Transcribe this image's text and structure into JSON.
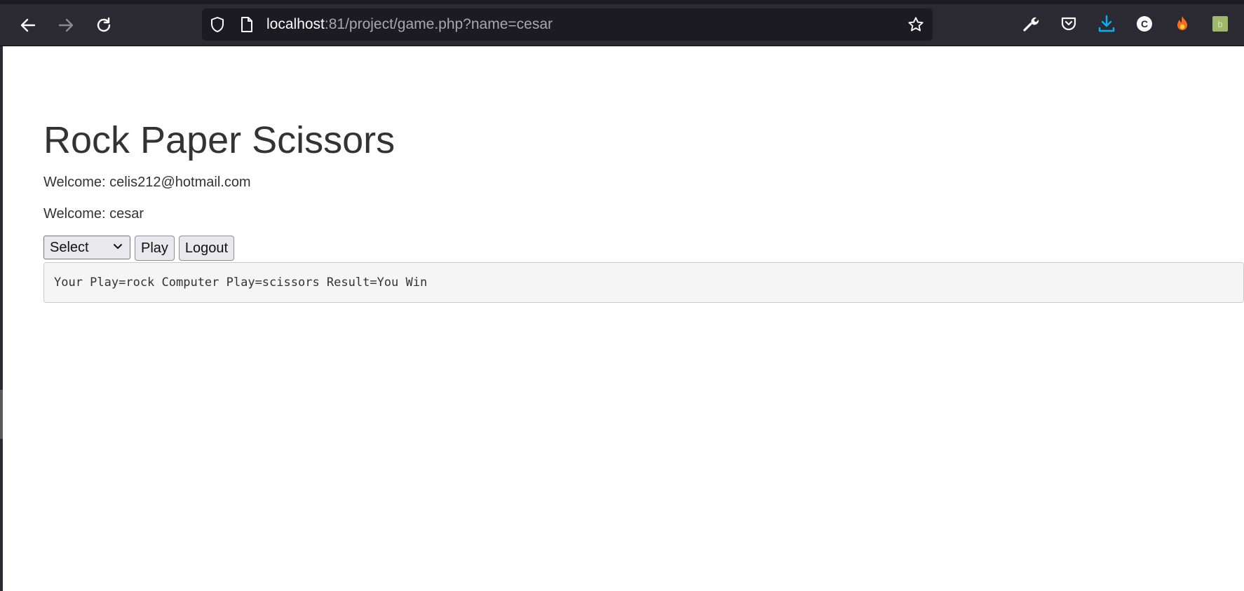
{
  "browser": {
    "url_host": "localhost",
    "url_rest": ":81/project/game.php?name=cesar",
    "icons": {
      "back": "arrow-left-icon",
      "forward": "arrow-right-icon",
      "reload": "reload-icon",
      "shield": "shield-icon",
      "page": "page-icon",
      "bookmark": "star-icon",
      "tools": "wrench-icon",
      "pocket": "pocket-icon",
      "downloads": "download-icon",
      "extension_c": "c-extension-icon",
      "extension_fire": "fire-extension-icon",
      "extension_green": "green-extension-icon"
    },
    "colors": {
      "toolbar_bg": "#2b2a33",
      "urlbar_bg": "#1c1b22",
      "download_accent": "#00b3f4"
    }
  },
  "page": {
    "title": "Rock Paper Scissors",
    "welcome_email": "Welcome: celis212@hotmail.com",
    "welcome_name": "Welcome: cesar",
    "select_value": "Select",
    "play_label": "Play",
    "logout_label": "Logout",
    "result_text": "Your Play=rock Computer Play=scissors Result=You Win"
  }
}
